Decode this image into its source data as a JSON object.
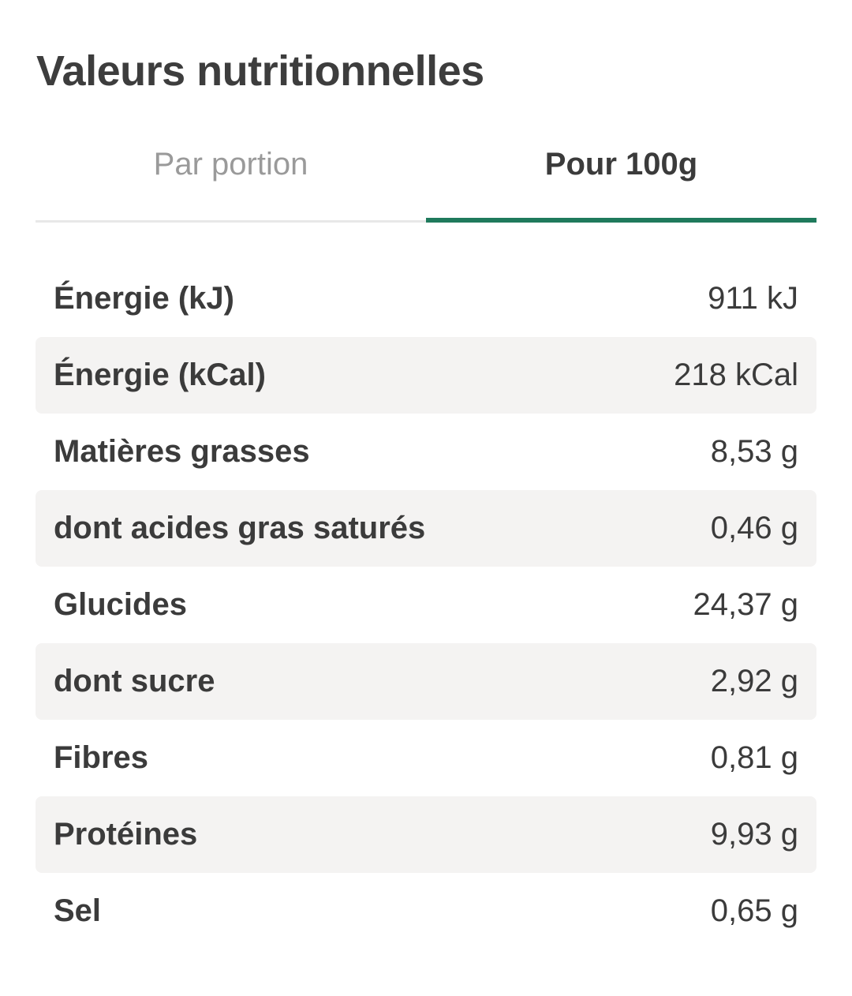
{
  "header": {
    "title": "Valeurs nutritionnelles"
  },
  "tabs": [
    {
      "label": "Par portion",
      "active": false
    },
    {
      "label": "Pour 100g",
      "active": true
    }
  ],
  "colors": {
    "accent": "#1f7a5c",
    "row_shade": "#f4f3f2",
    "text": "#3b3b3b",
    "inactive_tab": "#9a9a9a"
  },
  "nutrition": {
    "rows": [
      {
        "label": "Énergie (kJ)",
        "value": "911 kJ"
      },
      {
        "label": "Énergie (kCal)",
        "value": "218 kCal"
      },
      {
        "label": "Matières grasses",
        "value": "8,53 g"
      },
      {
        "label": "dont acides gras saturés",
        "value": "0,46 g"
      },
      {
        "label": "Glucides",
        "value": "24,37 g"
      },
      {
        "label": "dont sucre",
        "value": "2,92 g"
      },
      {
        "label": "Fibres",
        "value": "0,81 g"
      },
      {
        "label": "Protéines",
        "value": "9,93 g"
      },
      {
        "label": "Sel",
        "value": "0,65 g"
      }
    ]
  }
}
